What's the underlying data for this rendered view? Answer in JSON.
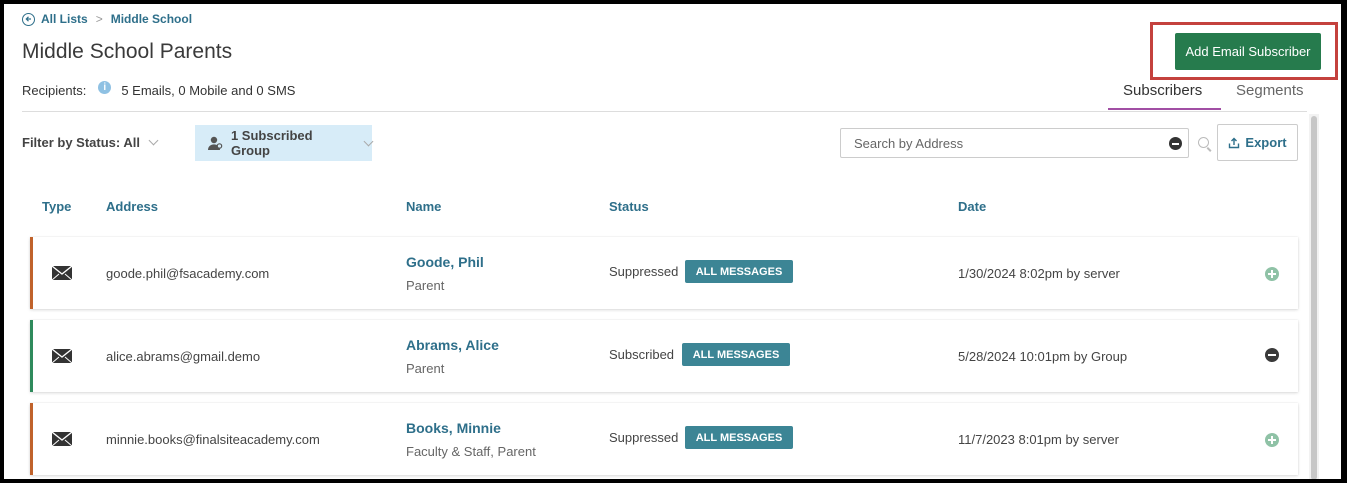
{
  "breadcrumb": {
    "root": "All Lists",
    "separator": ">",
    "current": "Middle School"
  },
  "page": {
    "title": "Middle School Parents"
  },
  "recipients": {
    "label": "Recipients:",
    "value": "5 Emails, 0 Mobile and 0 SMS"
  },
  "toolbar": {
    "add_label": "Add Email Subscriber",
    "export_label": "Export"
  },
  "tabs": [
    {
      "label": "Subscribers"
    },
    {
      "label": "Segments"
    }
  ],
  "filter": {
    "status_label": "Filter by Status: All",
    "group_label": "1 Subscribed Group"
  },
  "search": {
    "placeholder": "Search by Address"
  },
  "columns": {
    "type": "Type",
    "address": "Address",
    "name": "Name",
    "status": "Status",
    "date": "Date"
  },
  "rows": [
    {
      "address": "goode.phil@fsacademy.com",
      "name": "Goode, Phil",
      "role": "Parent",
      "status": "Suppressed",
      "badge": "ALL MESSAGES",
      "date": "1/30/2024 8:02pm by server",
      "bar_color": "#c0622b",
      "action": "add"
    },
    {
      "address": "alice.abrams@gmail.demo",
      "name": "Abrams, Alice",
      "role": "Parent",
      "status": "Subscribed",
      "badge": "ALL MESSAGES",
      "date": "5/28/2024 10:01pm by Group",
      "bar_color": "#2f8a5c",
      "action": "remove"
    },
    {
      "address": "minnie.books@finalsiteacademy.com",
      "name": "Books, Minnie",
      "role": "Faculty & Staff, Parent",
      "status": "Suppressed",
      "badge": "ALL MESSAGES",
      "date": "11/7/2023 8:01pm by server",
      "bar_color": "#c0622b",
      "action": "add"
    }
  ]
}
